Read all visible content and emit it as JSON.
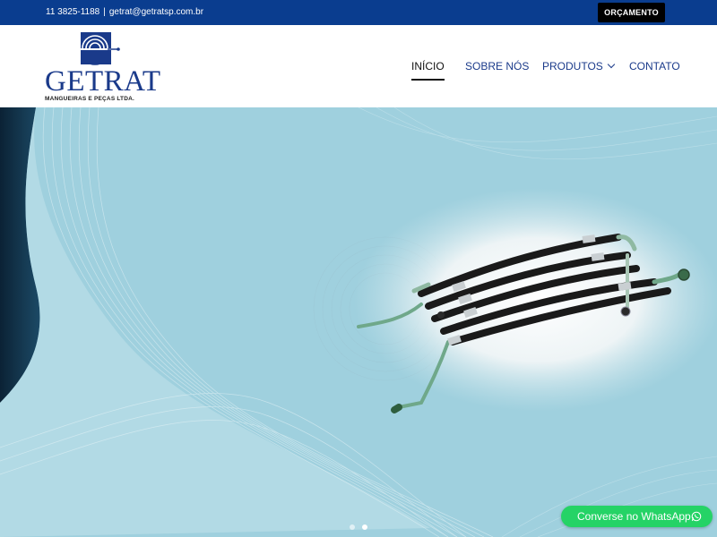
{
  "topbar": {
    "phone": "11 3825-1188",
    "separator": "|",
    "email": "getrat@getratsp.com.br",
    "quote_button": "ORÇAMENTO",
    "background_color": "#0a3d8f"
  },
  "logo": {
    "wordmark": "GETRAT",
    "tagline": "MANGUEIRAS E PEÇAS LTDA.",
    "color": "#1a3a8a"
  },
  "nav": {
    "items": [
      {
        "label": "INÍCIO",
        "active": true
      },
      {
        "label": "SOBRE NÓS",
        "active": false
      },
      {
        "label": "PRODUTOS",
        "active": false,
        "has_dropdown": true
      },
      {
        "label": "CONTATO",
        "active": false
      }
    ]
  },
  "hero": {
    "image": "air-conditioning-hose-assemblies",
    "slides": 2,
    "active_slide": 2
  },
  "whatsapp": {
    "label": "Converse no WhatsApp",
    "icon": "whatsapp-icon",
    "color": "#25d366"
  }
}
